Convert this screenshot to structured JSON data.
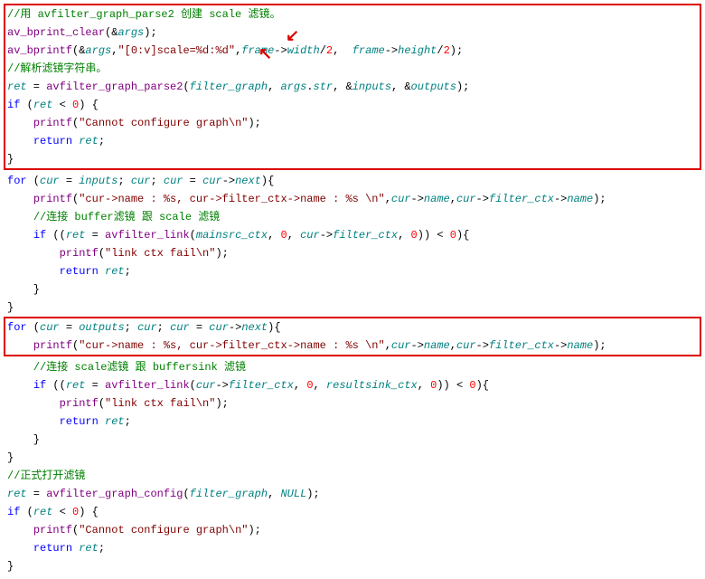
{
  "box1": {
    "l1": "//用 avfilter_graph_parse2 创建 scale 滤镜。",
    "l2a": "av_bprint_clear",
    "l2b": "args",
    "l3a": "av_bprintf",
    "l3b": "args",
    "l3c": "\"[0:v]scale=%d:%d\"",
    "l3d": "frame",
    "l3e": "width",
    "l3f": "frame",
    "l3g": "height",
    "l4": "//解析滤镜字符串。",
    "l5a": "avfilter_graph_parse2",
    "l5b": "filter_graph",
    "l5c": "args",
    "l5d": "str",
    "l5e": "inputs",
    "l5f": "outputs",
    "l6a": "if",
    "l6b": "ret",
    "l6c": "0",
    "l7a": "printf",
    "l7b": "\"Cannot configure graph\\n\"",
    "l8a": "return",
    "l8b": "ret"
  },
  "mid1": {
    "l1a": "for",
    "l1b": "cur",
    "l1c": "inputs",
    "l1d": "cur",
    "l1e": "cur",
    "l1f": "cur",
    "l1g": "next",
    "l2a": "printf",
    "l2b": "\"cur->name : %s, cur->filter_ctx->name : %s \\n\"",
    "l2c": "cur",
    "l2d": "name",
    "l2e": "cur",
    "l2f": "filter_ctx",
    "l2g": "name",
    "l3": "//连接 buffer滤镜 跟 scale 滤镜",
    "l4a": "if",
    "l4b": "ret",
    "l4c": "avfilter_link",
    "l4d": "mainsrc_ctx",
    "l4e": "0",
    "l4f": "cur",
    "l4g": "filter_ctx",
    "l4h": "0",
    "l4i": "0",
    "l5a": "printf",
    "l5b": "\"link ctx fail\\n\"",
    "l6a": "return",
    "l6b": "ret"
  },
  "box2": {
    "l1a": "for",
    "l1b": "cur",
    "l1c": "outputs",
    "l1d": "cur",
    "l1e": "cur",
    "l1f": "cur",
    "l1g": "next",
    "l2a": "printf",
    "l2b": "\"cur->name : %s, cur->filter_ctx->name : %s \\n\"",
    "l2c": "cur",
    "l2d": "name",
    "l2e": "cur",
    "l2f": "filter_ctx",
    "l2g": "name"
  },
  "mid2": {
    "l1": "//连接 scale滤镜 跟 buffersink 滤镜",
    "l2a": "if",
    "l2b": "ret",
    "l2c": "avfilter_link",
    "l2d": "cur",
    "l2e": "filter_ctx",
    "l2f": "0",
    "l2g": "resultsink_ctx",
    "l2h": "0",
    "l2i": "0",
    "l3a": "printf",
    "l3b": "\"link ctx fail\\n\"",
    "l4a": "return",
    "l4b": "ret"
  },
  "tail": {
    "l1": "//正式打开滤镜",
    "l2a": "ret",
    "l2b": "avfilter_graph_config",
    "l2c": "filter_graph",
    "l2d": "NULL",
    "l3a": "if",
    "l3b": "ret",
    "l3c": "0",
    "l4a": "printf",
    "l4b": "\"Cannot configure graph\\n\"",
    "l5a": "return",
    "l5b": "ret"
  }
}
